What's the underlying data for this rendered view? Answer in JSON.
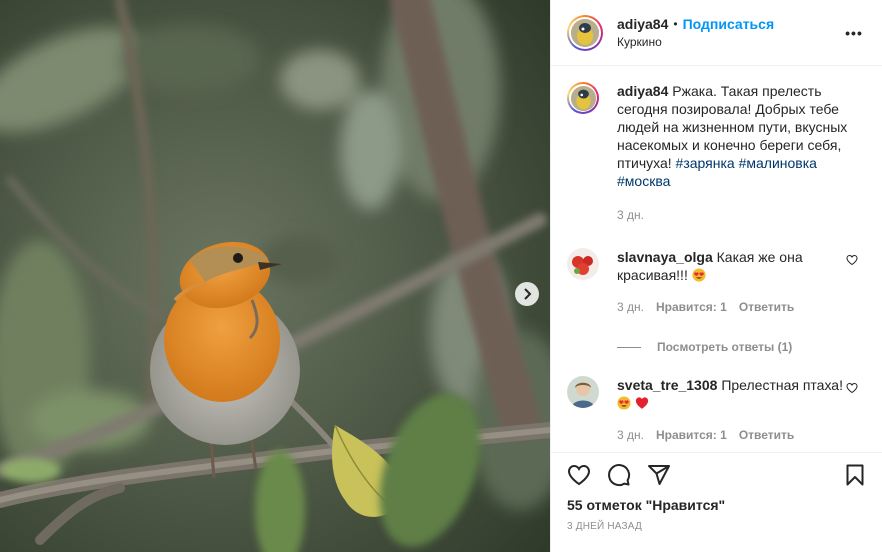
{
  "header": {
    "username": "adiya84",
    "separator": "•",
    "follow_label": "Подписаться",
    "location": "Куркино",
    "more_label": "•••"
  },
  "caption": {
    "username": "adiya84",
    "text": "Ржака. Такая прелесть сегодня позировала! Добрых тебе людей на жизненном пути, вкусных насекомых и конечно береги себя, птичуха!",
    "hashtags": [
      "#зарянка",
      "#малиновка",
      "#москва"
    ],
    "time": "3 дн."
  },
  "comments": [
    {
      "username": "slavnaya_olga",
      "text": "Какая же она красивая!!!",
      "emojis": [
        "heart-eyes-emoji"
      ],
      "time": "3 дн.",
      "likes": "Нравится: 1",
      "reply_label": "Ответить",
      "view_replies": "Посмотреть ответы (1)"
    },
    {
      "username": "sveta_tre_1308",
      "text": "Прелестная птаха!",
      "emojis": [
        "heart-eyes-emoji",
        "red-heart-emoji"
      ],
      "time": "3 дн.",
      "likes": "Нравится: 1",
      "reply_label": "Ответить"
    }
  ],
  "actions": {
    "icons": [
      "heart-icon",
      "comment-icon",
      "share-icon",
      "bookmark-icon"
    ],
    "likes_text": "55 отметок \"Нравится\"",
    "date": "3 ДНЕЙ НАЗАД"
  },
  "colors": {
    "follow": "#0095f6",
    "hashtag": "#00376b",
    "meta": "#8e8e8e",
    "heart_emoji": "#ed4956"
  }
}
